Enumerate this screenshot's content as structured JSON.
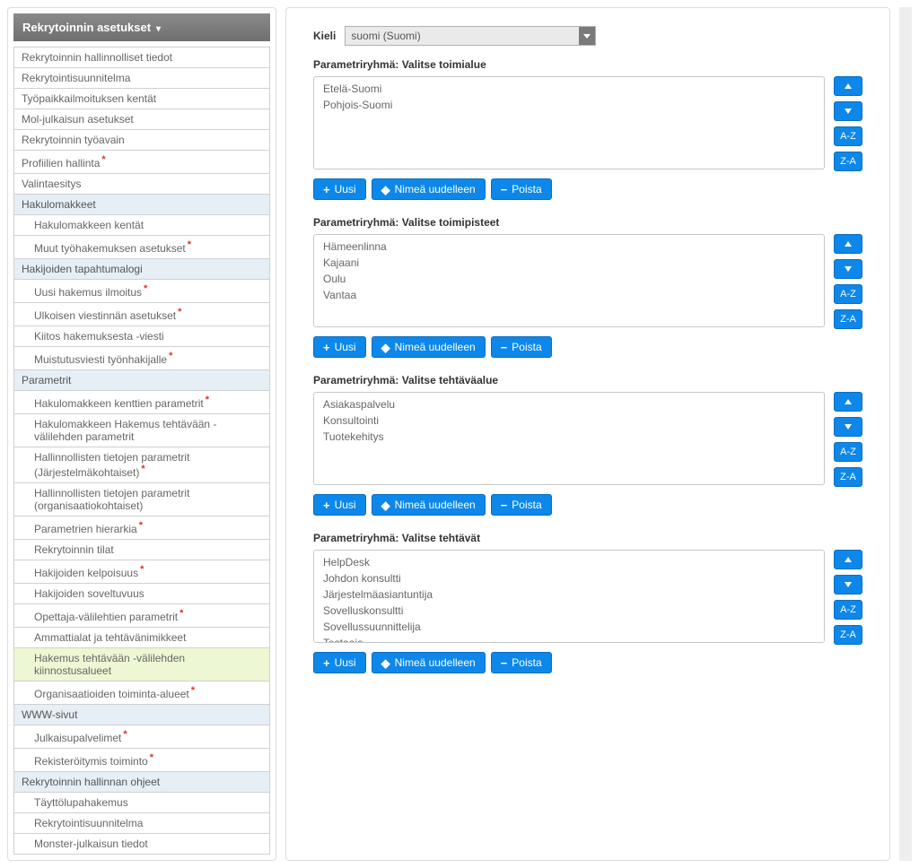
{
  "sidebar": {
    "title": "Rekrytoinnin asetukset",
    "items": [
      {
        "label": "Rekrytoinnin hallinnolliset tiedot",
        "type": "item"
      },
      {
        "label": "Rekrytointisuunnitelma",
        "type": "item"
      },
      {
        "label": "Työpaikkailmoituksen kentät",
        "type": "item"
      },
      {
        "label": "Mol-julkaisun asetukset",
        "type": "item"
      },
      {
        "label": "Rekrytoinnin työavain",
        "type": "item"
      },
      {
        "label": "Profiilien hallinta",
        "type": "item",
        "star": true
      },
      {
        "label": "Valintaesitys",
        "type": "item"
      },
      {
        "label": "Hakulomakkeet",
        "type": "section"
      },
      {
        "label": "Hakulomakkeen kentät",
        "type": "sub"
      },
      {
        "label": "Muut työhakemuksen asetukset",
        "type": "sub",
        "star": true
      },
      {
        "label": "Hakijoiden tapahtumalogi",
        "type": "section"
      },
      {
        "label": "Uusi hakemus ilmoitus",
        "type": "sub",
        "star": true
      },
      {
        "label": "Ulkoisen viestinnän asetukset",
        "type": "sub",
        "star": true
      },
      {
        "label": "Kiitos hakemuksesta -viesti",
        "type": "sub"
      },
      {
        "label": "Muistutusviesti työnhakijalle",
        "type": "sub",
        "star": true
      },
      {
        "label": "Parametrit",
        "type": "section"
      },
      {
        "label": "Hakulomakkeen kenttien parametrit",
        "type": "sub",
        "star": true
      },
      {
        "label": "Hakulomakkeen Hakemus tehtävään -välilehden parametrit",
        "type": "sub"
      },
      {
        "label": "Hallinnollisten tietojen parametrit (Järjestelmäkohtaiset)",
        "type": "sub",
        "star": true
      },
      {
        "label": "Hallinnollisten tietojen parametrit (organisaatiokohtaiset)",
        "type": "sub"
      },
      {
        "label": "Parametrien hierarkia",
        "type": "sub",
        "star": true
      },
      {
        "label": "Rekrytoinnin tilat",
        "type": "sub"
      },
      {
        "label": "Hakijoiden kelpoisuus",
        "type": "sub",
        "star": true
      },
      {
        "label": "Hakijoiden soveltuvuus",
        "type": "sub"
      },
      {
        "label": "Opettaja-välilehtien parametrit",
        "type": "sub",
        "star": true
      },
      {
        "label": "Ammattialat ja tehtävänimikkeet",
        "type": "sub"
      },
      {
        "label": "Hakemus tehtävään -välilehden kiinnostusalueet",
        "type": "sub",
        "active": true
      },
      {
        "label": "Organisaatioiden toiminta-alueet",
        "type": "sub",
        "star": true
      },
      {
        "label": "WWW-sivut",
        "type": "section"
      },
      {
        "label": "Julkaisupalvelimet",
        "type": "sub",
        "star": true
      },
      {
        "label": "Rekisteröitymis toiminto",
        "type": "sub",
        "star": true
      },
      {
        "label": "Rekrytoinnin hallinnan ohjeet",
        "type": "section"
      },
      {
        "label": "Täyttölupahakemus",
        "type": "sub"
      },
      {
        "label": "Rekrytointisuunnitelma",
        "type": "sub"
      },
      {
        "label": "Monster-julkaisun tiedot",
        "type": "sub"
      }
    ]
  },
  "main": {
    "lang_label": "Kieli",
    "lang_value": "suomi (Suomi)",
    "buttons": {
      "new": "Uusi",
      "rename": "Nimeä uudelleen",
      "delete": "Poista",
      "az": "A-Z",
      "za": "Z-A"
    },
    "groups": [
      {
        "title": "Parametriryhmä: Valitse toimialue",
        "options": [
          "Etelä-Suomi",
          "Pohjois-Suomi"
        ]
      },
      {
        "title": "Parametriryhmä: Valitse toimipisteet",
        "options": [
          "Hämeenlinna",
          "Kajaani",
          "Oulu",
          "Vantaa"
        ]
      },
      {
        "title": "Parametriryhmä: Valitse tehtäväalue",
        "options": [
          "Asiakaspalvelu",
          "Konsultointi",
          "Tuotekehitys"
        ]
      },
      {
        "title": "Parametriryhmä: Valitse tehtävät",
        "options": [
          "HelpDesk",
          "Johdon konsultti",
          "Järjestelmäasiantuntija",
          "Sovelluskonsultti",
          "Sovellussuunnittelija",
          "Testaaja"
        ],
        "scroll": true
      }
    ]
  }
}
